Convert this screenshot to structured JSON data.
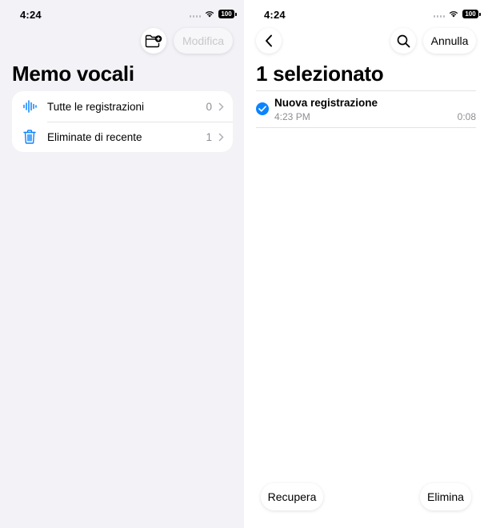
{
  "left": {
    "status": {
      "time": "4:24",
      "battery": "100"
    },
    "toolbar": {
      "edit_label": "Modifica"
    },
    "title": "Memo vocali",
    "rows": [
      {
        "label": "Tutte le registrazioni",
        "count": "0"
      },
      {
        "label": "Eliminate di recente",
        "count": "1"
      }
    ]
  },
  "right": {
    "status": {
      "time": "4:24",
      "battery": "100"
    },
    "toolbar": {
      "cancel_label": "Annulla"
    },
    "title": "1 selezionato",
    "recording": {
      "title": "Nuova registrazione",
      "time": "4:23 PM",
      "duration": "0:08",
      "selected": true
    },
    "bottom": {
      "recover_label": "Recupera",
      "delete_label": "Elimina"
    }
  },
  "colors": {
    "accent": "#0a84ff",
    "left_background": "#f2f2f7",
    "disabled_text": "#c8c8cc"
  }
}
